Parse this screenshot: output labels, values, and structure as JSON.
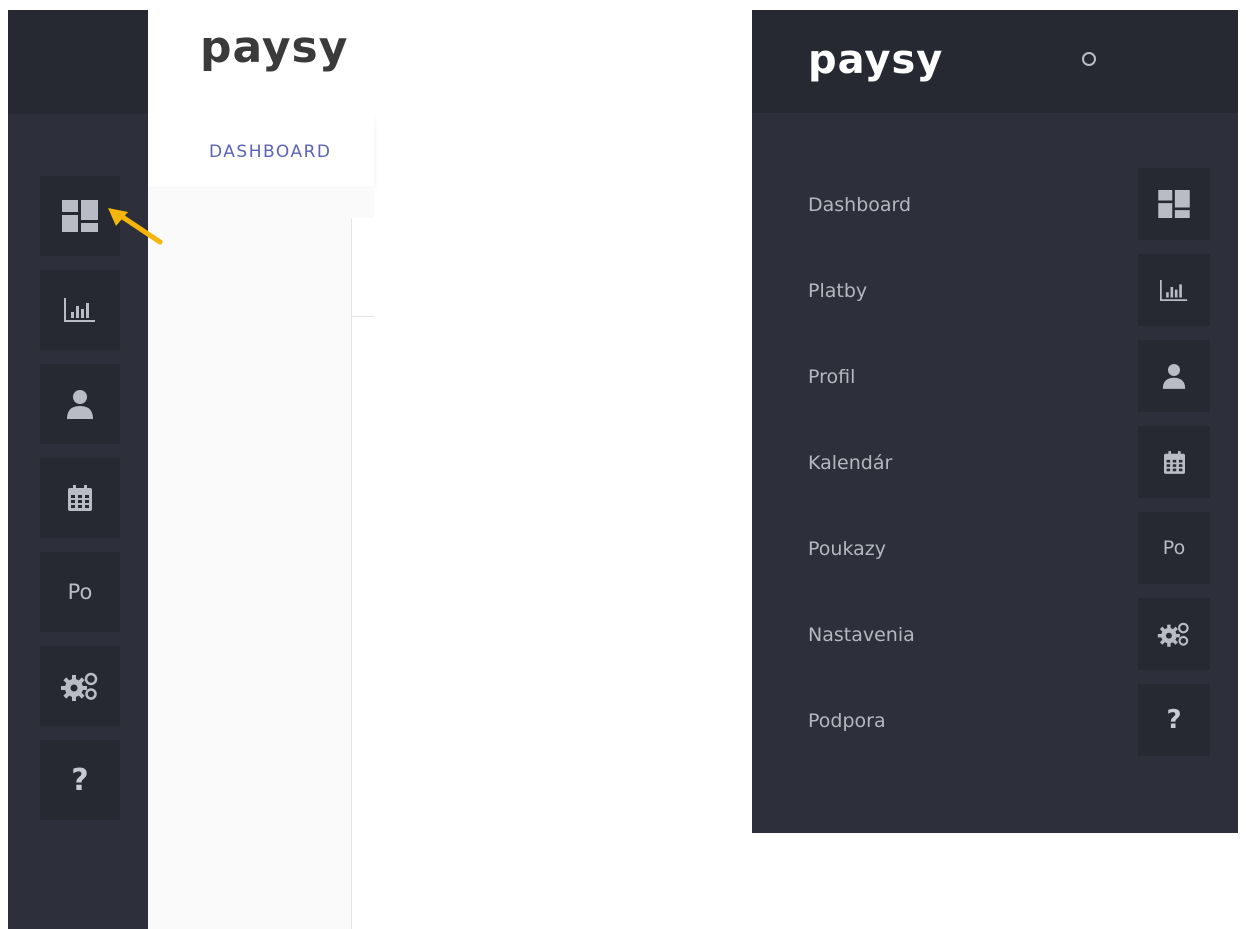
{
  "brand": {
    "logo_text": "paysy"
  },
  "colors": {
    "sidebar_bg": "#2d303a",
    "sidebar_header_bg": "#262931",
    "icon_button_bg": "#262931",
    "icon_color": "#b9bcc5",
    "nav_tab_color": "#5b63b7",
    "pointer_arrow": "#f5b50a"
  },
  "collapsed_view": {
    "top_nav": {
      "tab_label": "DASHBOARD"
    },
    "sidebar_buttons": [
      {
        "icon": "dashboard-icon"
      },
      {
        "icon": "chart-icon"
      },
      {
        "icon": "user-icon"
      },
      {
        "icon": "calendar-icon"
      },
      {
        "icon": "text-badge",
        "text": "Po"
      },
      {
        "icon": "settings-icon"
      },
      {
        "icon": "help-icon",
        "text": "?"
      }
    ],
    "pointer": "arrow-icon"
  },
  "expanded_view": {
    "menu": [
      {
        "label": "Dashboard",
        "icon": "dashboard-icon"
      },
      {
        "label": "Platby",
        "icon": "chart-icon"
      },
      {
        "label": "Profil",
        "icon": "user-icon"
      },
      {
        "label": "Kalendár",
        "icon": "calendar-icon"
      },
      {
        "label": "Poukazy",
        "icon": "text-badge",
        "text": "Po"
      },
      {
        "label": "Nastavenia",
        "icon": "settings-icon"
      },
      {
        "label": "Podpora",
        "icon": "help-icon",
        "text": "?"
      }
    ]
  }
}
